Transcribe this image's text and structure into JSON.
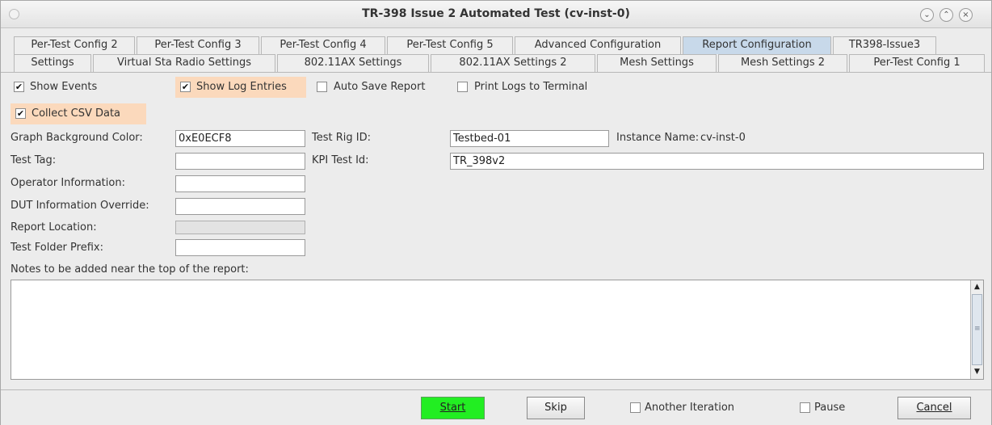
{
  "window": {
    "title": "TR-398 Issue 2 Automated Test  (cv-inst-0)"
  },
  "tabs_row1": [
    {
      "label": "Per-Test Config 2"
    },
    {
      "label": "Per-Test Config 3"
    },
    {
      "label": "Per-Test Config 4"
    },
    {
      "label": "Per-Test Config 5"
    },
    {
      "label": "Advanced Configuration"
    },
    {
      "label": "Report Configuration"
    },
    {
      "label": "TR398-Issue3"
    }
  ],
  "tabs_row2": [
    {
      "label": "Settings"
    },
    {
      "label": "Virtual Sta Radio Settings"
    },
    {
      "label": "802.11AX Settings"
    },
    {
      "label": "802.11AX Settings 2"
    },
    {
      "label": "Mesh Settings"
    },
    {
      "label": "Mesh Settings 2"
    },
    {
      "label": "Per-Test Config 1"
    }
  ],
  "options": {
    "show_events": {
      "label": "Show Events",
      "checked": true
    },
    "show_log_entries": {
      "label": "Show Log Entries",
      "checked": true
    },
    "auto_save_report": {
      "label": "Auto Save Report",
      "checked": false
    },
    "print_logs": {
      "label": "Print Logs to Terminal",
      "checked": false
    },
    "collect_csv": {
      "label": "Collect CSV Data",
      "checked": true
    }
  },
  "fields": {
    "graph_bg_color": {
      "label": "Graph Background Color:",
      "value": "0xE0ECF8"
    },
    "test_rig_id": {
      "label": "Test Rig ID:",
      "value": "Testbed-01"
    },
    "instance_name": {
      "label": "Instance Name:",
      "value": "cv-inst-0"
    },
    "test_tag": {
      "label": "Test Tag:",
      "value": ""
    },
    "kpi_test_id": {
      "label": "KPI Test Id:",
      "value": "TR_398v2"
    },
    "operator_info": {
      "label": "Operator Information:",
      "value": ""
    },
    "dut_override": {
      "label": "DUT Information Override:",
      "value": ""
    },
    "report_location": {
      "label": "Report Location:",
      "value": ""
    },
    "test_folder_prefix": {
      "label": "Test Folder Prefix:",
      "value": ""
    }
  },
  "notes": {
    "label": "Notes to be added near the top of the report:",
    "value": ""
  },
  "bottom": {
    "start": "Start",
    "skip": "Skip",
    "another_iteration": "Another Iteration",
    "pause": "Pause",
    "cancel": "Cancel"
  },
  "colors": {
    "active_tab": "#c8d9ea",
    "highlight": "#fbd9bc",
    "start_button": "#22ee22"
  }
}
